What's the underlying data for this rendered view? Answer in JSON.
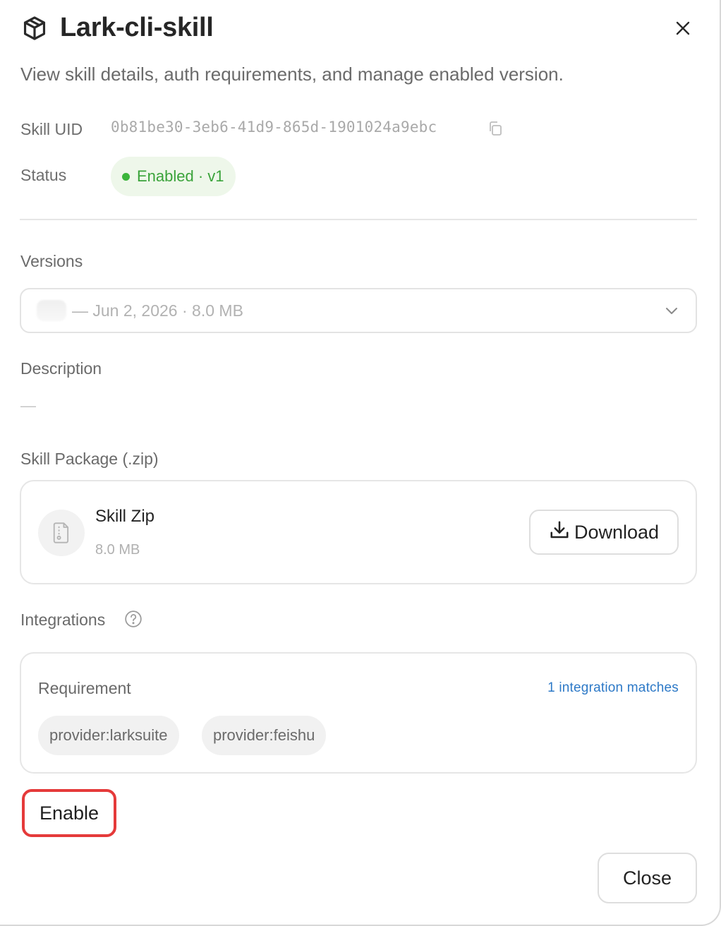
{
  "header": {
    "title": "Lark-cli-skill",
    "subtitle": "View skill details, auth requirements, and manage enabled version.",
    "title_icon": "package-icon",
    "close_icon": "close-icon"
  },
  "details": {
    "uid_label": "Skill UID",
    "uid_value": "0b81be30-3eb6-41d9-865d-1901024a9ebc",
    "copy_icon": "copy-icon",
    "status_label": "Status",
    "status_value": "Enabled · v1",
    "status_color": "#3bb53b"
  },
  "versions": {
    "label": "Versions",
    "selected": "— Jun 2, 2026 · 8.0 MB",
    "chevron_icon": "chevron-down-icon"
  },
  "description": {
    "label": "Description",
    "value": "—"
  },
  "package": {
    "label": "Skill Package (.zip)",
    "file_name": "Skill Zip",
    "file_size": "8.0 MB",
    "file_icon": "zip-file-icon",
    "download_label": "Download",
    "download_icon": "download-icon"
  },
  "integrations": {
    "label": "Integrations",
    "help_icon": "help-icon",
    "requirement_label": "Requirement",
    "match_text": "1 integration matches",
    "match_color": "#2d79c7",
    "tags": [
      "provider:larksuite",
      "provider:feishu"
    ]
  },
  "actions": {
    "enable_label": "Enable",
    "enable_highlight_color": "#e53a3a",
    "close_label": "Close"
  }
}
